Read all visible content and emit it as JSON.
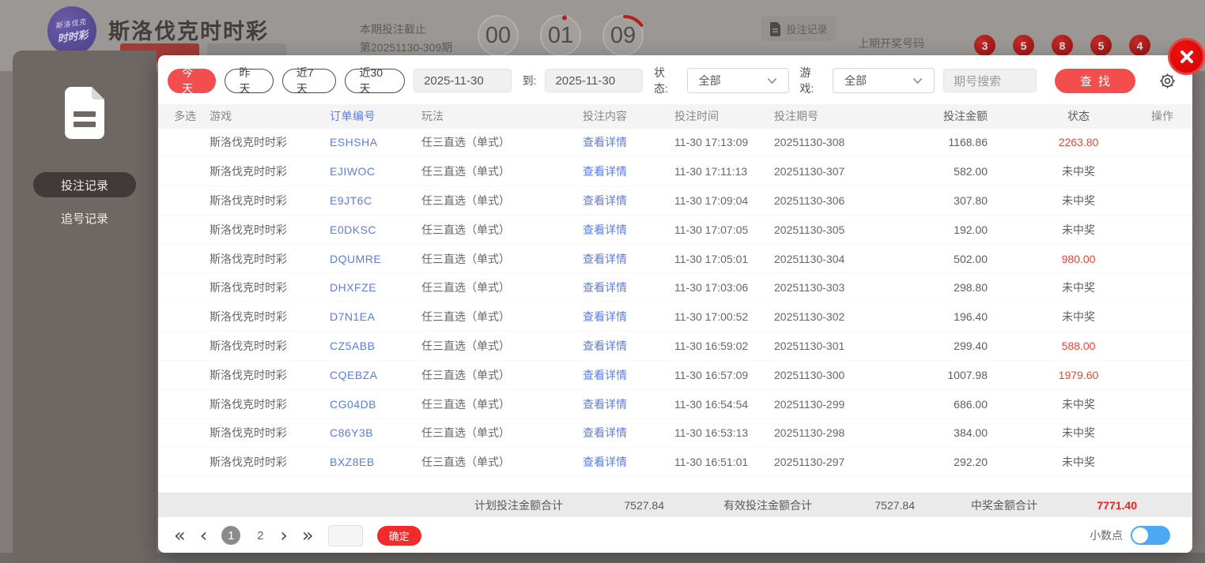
{
  "page": {
    "logo_line1": "斯洛伐克",
    "logo_line2": "时时彩",
    "title": "斯洛伐克时时彩",
    "deadline_label": "本期投注截止",
    "period_label": "第20251130-309期",
    "countdown": {
      "hours": "00",
      "minutes": "01",
      "seconds": "09"
    },
    "records_button": "投注记录",
    "last_draw_label": "上期开奖号码",
    "last_draw_numbers": [
      "3",
      "5",
      "8",
      "5",
      "4"
    ]
  },
  "sidebar": {
    "items": [
      {
        "label": "投注记录",
        "active": true
      },
      {
        "label": "追号记录",
        "active": false
      }
    ]
  },
  "filters": {
    "quick": [
      {
        "label": "今天",
        "active": true
      },
      {
        "label": "昨天",
        "active": false
      },
      {
        "label": "近7天",
        "active": false
      },
      {
        "label": "近30天",
        "active": false
      }
    ],
    "date_from": "2025-11-30",
    "to_label": "到:",
    "date_to": "2025-11-30",
    "status_label": "状态:",
    "status_value": "全部",
    "game_label": "游戏:",
    "game_value": "全部",
    "search_placeholder": "期号搜索",
    "find_button": "查找"
  },
  "table": {
    "headers": [
      "多选",
      "游戏",
      "订单编号",
      "玩法",
      "投注内容",
      "投注时间",
      "投注期号",
      "投注金额",
      "状态",
      "操作"
    ],
    "detail_link": "查看详情",
    "rows": [
      {
        "game": "斯洛伐克时时彩",
        "order": "ESHSHA",
        "play": "任三直选（单式）",
        "time": "11-30 17:13:09",
        "period": "20251130-308",
        "amount": "1168.86",
        "status": "2263.80",
        "win": true
      },
      {
        "game": "斯洛伐克时时彩",
        "order": "EJIWOC",
        "play": "任三直选（单式）",
        "time": "11-30 17:11:13",
        "period": "20251130-307",
        "amount": "582.00",
        "status": "未中奖",
        "win": false
      },
      {
        "game": "斯洛伐克时时彩",
        "order": "E9JT6C",
        "play": "任三直选（单式）",
        "time": "11-30 17:09:04",
        "period": "20251130-306",
        "amount": "307.80",
        "status": "未中奖",
        "win": false
      },
      {
        "game": "斯洛伐克时时彩",
        "order": "E0DKSC",
        "play": "任三直选（单式）",
        "time": "11-30 17:07:05",
        "period": "20251130-305",
        "amount": "192.00",
        "status": "未中奖",
        "win": false
      },
      {
        "game": "斯洛伐克时时彩",
        "order": "DQUMRE",
        "play": "任三直选（单式）",
        "time": "11-30 17:05:01",
        "period": "20251130-304",
        "amount": "502.00",
        "status": "980.00",
        "win": true
      },
      {
        "game": "斯洛伐克时时彩",
        "order": "DHXFZE",
        "play": "任三直选（单式）",
        "time": "11-30 17:03:06",
        "period": "20251130-303",
        "amount": "298.80",
        "status": "未中奖",
        "win": false
      },
      {
        "game": "斯洛伐克时时彩",
        "order": "D7N1EA",
        "play": "任三直选（单式）",
        "time": "11-30 17:00:52",
        "period": "20251130-302",
        "amount": "196.40",
        "status": "未中奖",
        "win": false
      },
      {
        "game": "斯洛伐克时时彩",
        "order": "CZ5ABB",
        "play": "任三直选（单式）",
        "time": "11-30 16:59:02",
        "period": "20251130-301",
        "amount": "299.40",
        "status": "588.00",
        "win": true
      },
      {
        "game": "斯洛伐克时时彩",
        "order": "CQEBZA",
        "play": "任三直选（单式）",
        "time": "11-30 16:57:09",
        "period": "20251130-300",
        "amount": "1007.98",
        "status": "1979.60",
        "win": true
      },
      {
        "game": "斯洛伐克时时彩",
        "order": "CG04DB",
        "play": "任三直选（单式）",
        "time": "11-30 16:54:54",
        "period": "20251130-299",
        "amount": "686.00",
        "status": "未中奖",
        "win": false
      },
      {
        "game": "斯洛伐克时时彩",
        "order": "C86Y3B",
        "play": "任三直选（单式）",
        "time": "11-30 16:53:13",
        "period": "20251130-298",
        "amount": "384.00",
        "status": "未中奖",
        "win": false
      },
      {
        "game": "斯洛伐克时时彩",
        "order": "BXZ8EB",
        "play": "任三直选（单式）",
        "time": "11-30 16:51:01",
        "period": "20251130-297",
        "amount": "292.20",
        "status": "未中奖",
        "win": false
      }
    ]
  },
  "summary": {
    "plan_label": "计划投注金额合计",
    "plan_value": "7527.84",
    "valid_label": "有效投注金额合计",
    "valid_value": "7527.84",
    "win_label": "中奖金额合计",
    "win_value": "7771.40"
  },
  "pagination": {
    "first_icon": "«",
    "prev_icon": "‹",
    "next_icon": "›",
    "last_icon": "»",
    "pages": [
      "1",
      "2"
    ],
    "current": "1",
    "confirm_button": "确定"
  },
  "footer": {
    "decimal_label": "小数点"
  },
  "colors": {
    "accent_red": "#f34d4d",
    "link_blue": "#5d7ce2",
    "win_red": "#ef4433",
    "toggle_blue": "#4aa8f5"
  }
}
